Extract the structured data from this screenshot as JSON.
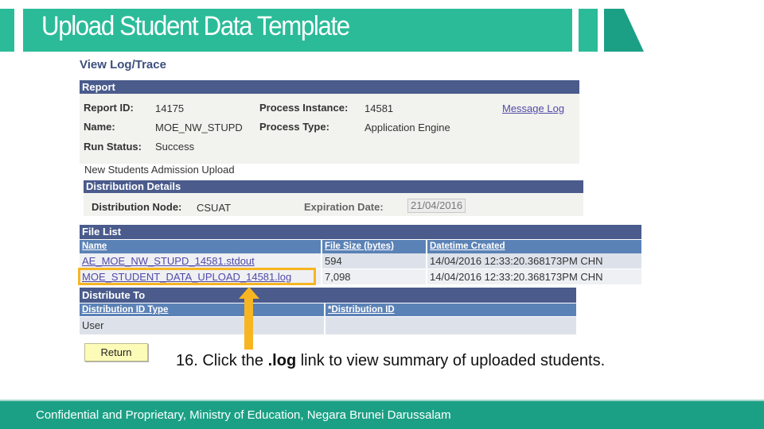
{
  "slide": {
    "title": "Upload Student Data Template",
    "instruction_prefix": "16. Click the ",
    "instruction_bold": ".log",
    "instruction_suffix": " link to view summary of uploaded students.",
    "footer": "Confidential and Proprietary, Ministry of Education, Negara Brunei Darussalam",
    "accent_color": "#2bbb99",
    "highlight_color": "#f7b521"
  },
  "page": {
    "title": "View Log/Trace"
  },
  "report": {
    "header": "Report",
    "report_id_label": "Report ID:",
    "report_id": "14175",
    "process_instance_label": "Process Instance:",
    "process_instance": "14581",
    "message_log_link": "Message Log",
    "name_label": "Name:",
    "name": "MOE_NW_STUPD",
    "process_type_label": "Process Type:",
    "process_type": "Application Engine",
    "run_status_label": "Run Status:",
    "run_status": "Success",
    "description": "New Students Admission Upload"
  },
  "distribution_details": {
    "header": "Distribution Details",
    "node_label": "Distribution Node:",
    "node": "CSUAT",
    "expiration_label": "Expiration Date:",
    "expiration": "21/04/2016"
  },
  "file_list": {
    "header": "File List",
    "columns": [
      "Name",
      "File Size (bytes)",
      "Datetime Created"
    ],
    "rows": [
      {
        "name": "AE_MOE_NW_STUPD_14581.stdout",
        "size": "594",
        "created": "14/04/2016 12:33:20.368173PM CHN"
      },
      {
        "name": "MOE_STUDENT_DATA_UPLOAD_14581.log",
        "size": "7,098",
        "created": "14/04/2016 12:33:20.368173PM CHN"
      }
    ]
  },
  "distribute_to": {
    "header": "Distribute To",
    "columns": [
      "Distribution ID Type",
      "*Distribution ID"
    ],
    "rows": [
      {
        "type": "User",
        "id": ""
      }
    ]
  },
  "buttons": {
    "return": "Return"
  }
}
